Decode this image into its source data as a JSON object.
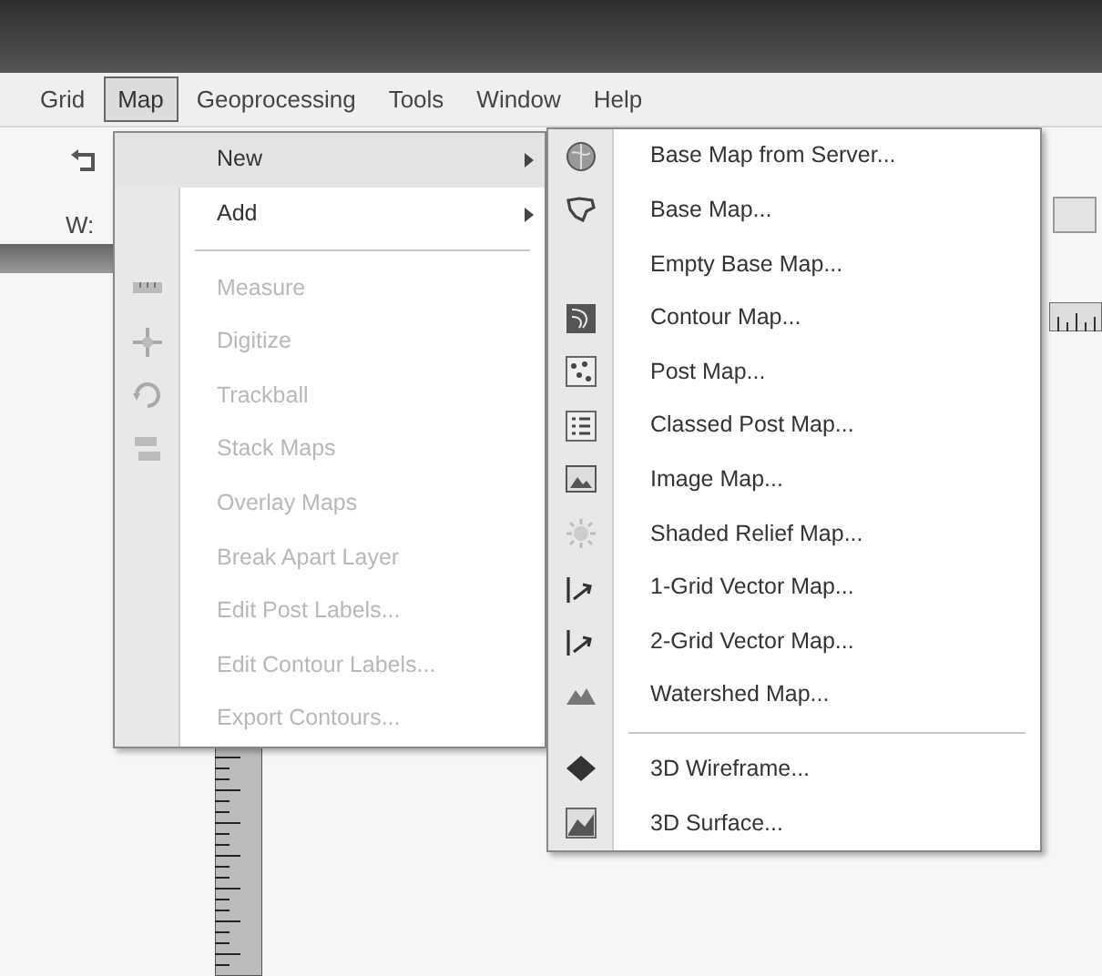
{
  "menu_bar": [
    {
      "label": "Grid",
      "selected": false
    },
    {
      "label": "Map",
      "selected": true
    },
    {
      "label": "Geoprocessing",
      "selected": false
    },
    {
      "label": "Tools",
      "selected": false
    },
    {
      "label": "Window",
      "selected": false
    },
    {
      "label": "Help",
      "selected": false
    }
  ],
  "toolbar": {
    "label": "W:"
  },
  "map_menu": [
    {
      "kind": "item",
      "label": "New",
      "submenu": true,
      "selected": true,
      "disabled": false
    },
    {
      "kind": "item",
      "label": "Add",
      "submenu": true,
      "selected": false,
      "disabled": false
    },
    {
      "kind": "separator"
    },
    {
      "kind": "item",
      "label": "Measure",
      "submenu": false,
      "selected": false,
      "disabled": true
    },
    {
      "kind": "item",
      "label": "Digitize",
      "submenu": false,
      "selected": false,
      "disabled": true
    },
    {
      "kind": "item",
      "label": "Trackball",
      "submenu": false,
      "selected": false,
      "disabled": true
    },
    {
      "kind": "item",
      "label": "Stack Maps",
      "submenu": false,
      "selected": false,
      "disabled": true
    },
    {
      "kind": "item",
      "label": "Overlay Maps",
      "submenu": false,
      "selected": false,
      "disabled": true
    },
    {
      "kind": "item",
      "label": "Break Apart Layer",
      "submenu": false,
      "selected": false,
      "disabled": true
    },
    {
      "kind": "item",
      "label": "Edit Post Labels...",
      "submenu": false,
      "selected": false,
      "disabled": true
    },
    {
      "kind": "item",
      "label": "Edit Contour Labels...",
      "submenu": false,
      "selected": false,
      "disabled": true
    },
    {
      "kind": "item",
      "label": "Export Contours...",
      "submenu": false,
      "selected": false,
      "disabled": true
    }
  ],
  "new_submenu": [
    {
      "kind": "item",
      "label": "Base Map from Server..."
    },
    {
      "kind": "item",
      "label": "Base Map..."
    },
    {
      "kind": "item",
      "label": "Empty Base Map..."
    },
    {
      "kind": "item",
      "label": "Contour Map..."
    },
    {
      "kind": "item",
      "label": "Post Map..."
    },
    {
      "kind": "item",
      "label": "Classed Post Map..."
    },
    {
      "kind": "item",
      "label": "Image Map..."
    },
    {
      "kind": "item",
      "label": "Shaded Relief Map..."
    },
    {
      "kind": "item",
      "label": "1-Grid Vector Map..."
    },
    {
      "kind": "item",
      "label": "2-Grid Vector Map..."
    },
    {
      "kind": "item",
      "label": "Watershed Map..."
    },
    {
      "kind": "separator"
    },
    {
      "kind": "item",
      "label": "3D Wireframe..."
    },
    {
      "kind": "item",
      "label": "3D Surface..."
    }
  ]
}
